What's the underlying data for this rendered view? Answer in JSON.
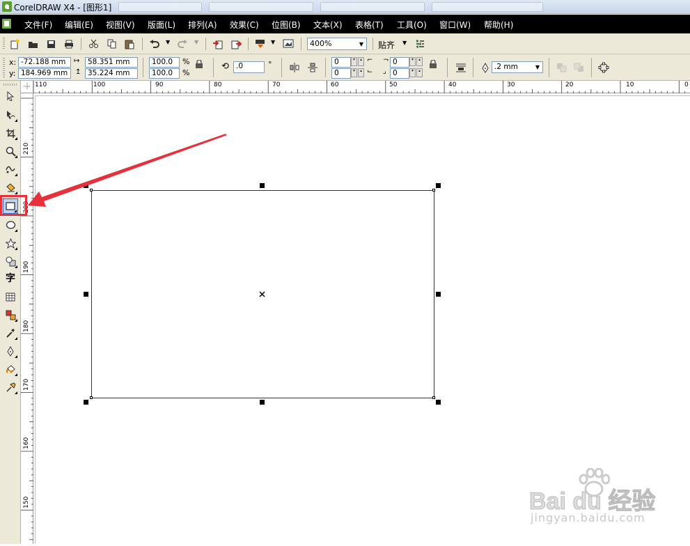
{
  "window": {
    "title": "CorelDRAW X4 - [图形1]"
  },
  "menu": {
    "items": [
      "文件(F)",
      "编辑(E)",
      "视图(V)",
      "版面(L)",
      "排列(A)",
      "效果(C)",
      "位图(B)",
      "文本(X)",
      "表格(T)",
      "工具(O)",
      "窗口(W)",
      "帮助(H)"
    ]
  },
  "standard_toolbar": {
    "zoom_level": "400%",
    "snap_label": "贴齐",
    "icons": [
      "new-icon",
      "open-icon",
      "save-icon",
      "print-icon",
      "cut-icon",
      "copy-icon",
      "paste-icon",
      "undo-icon",
      "redo-icon",
      "import-icon",
      "export-icon",
      "app-launcher-icon",
      "welcome-screen-icon",
      "options-icon"
    ]
  },
  "property_bar": {
    "x_label": "x:",
    "x_value": "-72.188 mm",
    "y_label": "y:",
    "y_value": "184.969 mm",
    "width_value": "58.351 mm",
    "height_value": "35.224 mm",
    "scale_x": "100.0",
    "scale_y": "100.0",
    "percent": "%",
    "rotation_value": ".0",
    "degree": "°",
    "corner_tl": "0",
    "corner_bl": "0",
    "corner_tr": "0",
    "corner_br": "0",
    "outline_width": ".2 mm"
  },
  "toolbox": {
    "tools": [
      "pick-tool-icon",
      "shape-tool-icon",
      "crop-tool-icon",
      "zoom-tool-icon",
      "freehand-tool-icon",
      "smart-fill-icon",
      "rectangle-tool-icon",
      "ellipse-tool-icon",
      "polygon-tool-icon",
      "basic-shapes-icon",
      "text-tool-icon",
      "table-tool-icon",
      "interactive-blend-icon",
      "eyedropper-icon",
      "outline-pen-icon",
      "fill-tool-icon",
      "interactive-fill-icon"
    ],
    "text_tool_glyph": "字",
    "selected_tool": "rectangle-tool-icon"
  },
  "rulers": {
    "horizontal_labels": [
      "110",
      "100",
      "90",
      "80",
      "70",
      "60",
      "50",
      "40",
      "30",
      "20",
      "10",
      "0"
    ],
    "vertical_labels": [
      "210",
      "200",
      "190",
      "180",
      "170",
      "160",
      "150"
    ]
  },
  "watermark": {
    "brand": "Bai du 经验",
    "url": "jingyan.baidu.com"
  },
  "colors": {
    "menubar": "#000000",
    "toolbar": "#ece9d8",
    "highlight": "#e8303a",
    "arrow": "#e8303a"
  }
}
